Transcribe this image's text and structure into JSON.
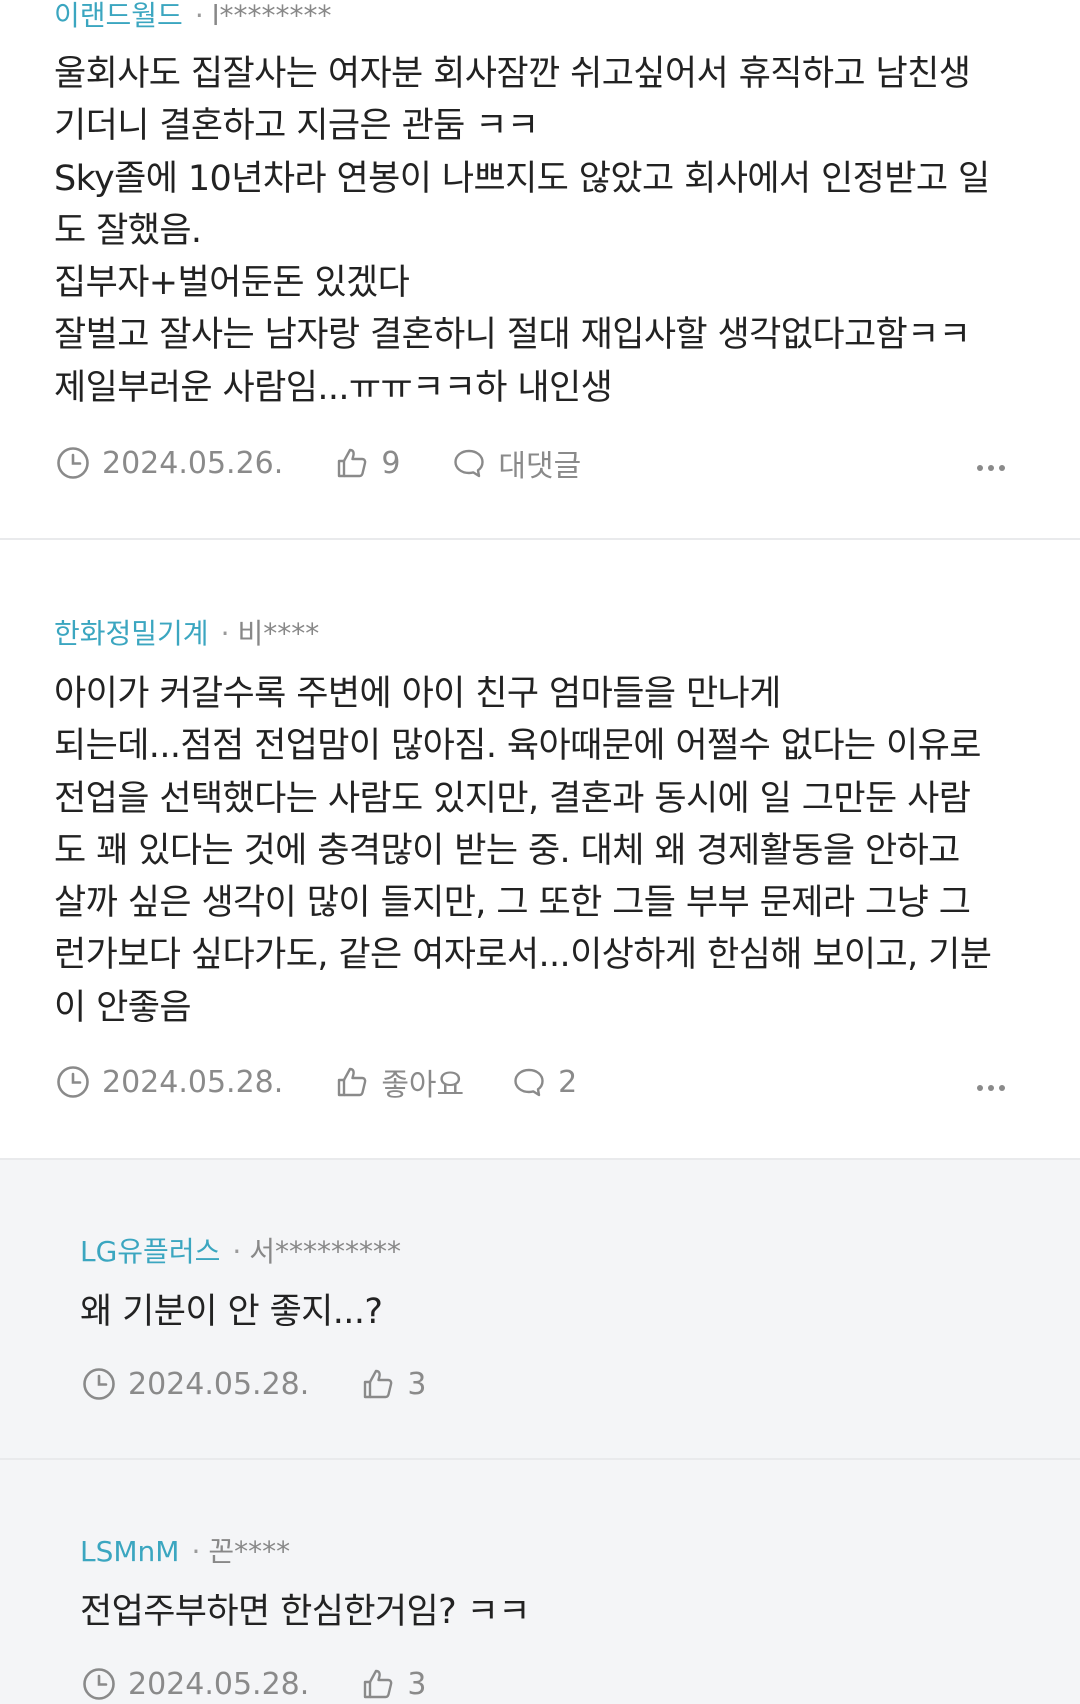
{
  "comments": [
    {
      "company": "이랜드월드",
      "user": "l********",
      "text": "울회사도 집잘사는 여자분 회사잠깐 쉬고싶어서 휴직하고 남친생\n기더니 결혼하고 지금은 관둠 ㅋㅋ\nSky졸에 10년차라 연봉이 나쁘지도 않았고 회사에서 인정받고 일\n도 잘했음.\n집부자+벌어둔돈 있겠다\n잘벌고 잘사는 남자랑 결혼하니 절대 재입사할 생각없다고함ㅋㅋ\n제일부러운 사람임...ㅠㅠㅋㅋ하 내인생",
      "date": "2024.05.26.",
      "likes": "9",
      "reply_label": "대댓글"
    },
    {
      "company": "한화정밀기계",
      "user": "비****",
      "text": "아이가 커갈수록 주변에 아이 친구 엄마들을 만나게\n되는데...점점 전업맘이 많아짐. 육아때문에 어쩔수 없다는 이유로\n전업을 선택했다는 사람도 있지만, 결혼과 동시에 일 그만둔 사람\n도 꽤 있다는 것에 충격많이 받는 중. 대체 왜 경제활동을 안하고\n살까 싶은 생각이 많이 들지만, 그 또한 그들 부부 문제라 그냥 그\n런가보다 싶다가도, 같은 여자로서...이상하게 한심해 보이고, 기분\n이 안좋음",
      "date": "2024.05.28.",
      "likes": "좋아요",
      "reply_label": "2"
    },
    {
      "company": "LG유플러스",
      "user": "서*********",
      "text": "왜 기분이 안 좋지...?",
      "date": "2024.05.28.",
      "likes": "3"
    },
    {
      "company": "LSMnM",
      "user": "꼰****",
      "text": "전업주부하면 한심한거임? ㅋㅋ",
      "date": "2024.05.28.",
      "likes": "3"
    }
  ],
  "icons": {
    "date": "clock-icon",
    "like": "thumbs-up-icon",
    "reply": "speech-bubble-icon",
    "more": "more-dots-icon"
  },
  "colors": {
    "company": "#3ba6c0",
    "muted": "#8a8a8a",
    "text": "#222222",
    "reply_bg": "#f4f5f7",
    "divider": "#e9eaec"
  }
}
